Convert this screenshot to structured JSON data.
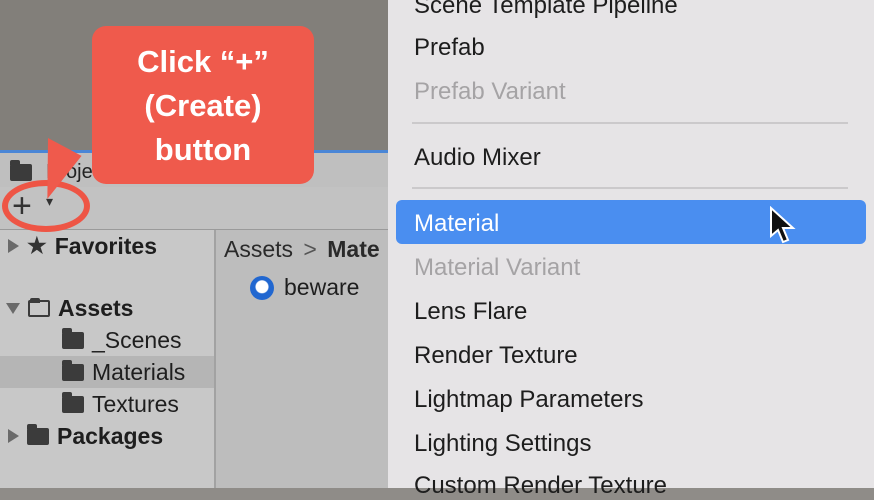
{
  "left_panel": {
    "project_tab_label": "Proje",
    "toolbar": {
      "create_button_label": "+",
      "create_caret": "▾"
    },
    "tree": [
      {
        "label": "Favorites",
        "icon": "star-icon",
        "bold": true
      },
      {
        "label": "Assets",
        "icon": "folder-open-icon",
        "bold": true
      },
      {
        "label": "_Scenes",
        "icon": "folder-icon",
        "bold": false
      },
      {
        "label": "Materials",
        "icon": "folder-icon",
        "bold": false,
        "selected": true
      },
      {
        "label": "Textures",
        "icon": "folder-icon",
        "bold": false
      },
      {
        "label": "Packages",
        "icon": "folder-icon",
        "bold": true
      }
    ],
    "breadcrumb": {
      "root": "Assets",
      "separator": ">",
      "current": "Mate"
    },
    "assets": [
      {
        "label": "beware",
        "icon": "material-sphere-icon"
      }
    ]
  },
  "callout": {
    "lines": [
      "Click “+”",
      "(Create)",
      "button"
    ],
    "color": "#ef5a4c"
  },
  "context_menu": {
    "items": [
      {
        "label": "Scene Template Pipeline",
        "disabled": false
      },
      {
        "label": "Prefab",
        "disabled": false
      },
      {
        "label": "Prefab Variant",
        "disabled": true
      },
      {
        "label": "Audio Mixer",
        "disabled": false
      },
      {
        "label": "Material",
        "disabled": false,
        "highlighted": true
      },
      {
        "label": "Material Variant",
        "disabled": true
      },
      {
        "label": "Lens Flare",
        "disabled": false
      },
      {
        "label": "Render Texture",
        "disabled": false
      },
      {
        "label": "Lightmap Parameters",
        "disabled": false
      },
      {
        "label": "Lighting Settings",
        "disabled": false
      },
      {
        "label": "Custom Render Texture",
        "disabled": false
      }
    ],
    "highlight_color": "#4a8ef0"
  }
}
